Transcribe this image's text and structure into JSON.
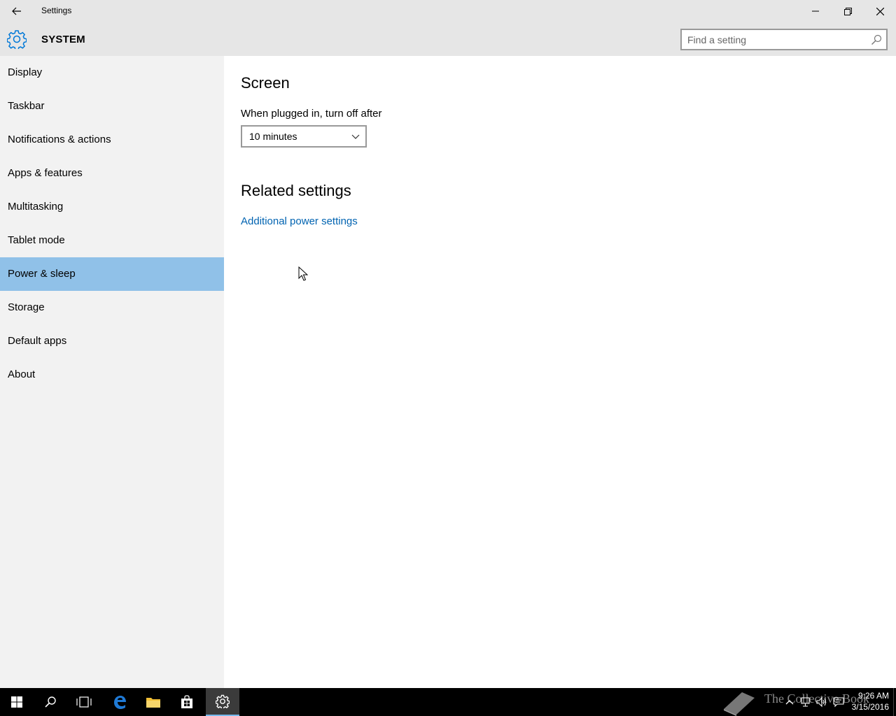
{
  "titlebar": {
    "title": "Settings"
  },
  "header": {
    "section_title": "SYSTEM",
    "search_placeholder": "Find a setting"
  },
  "sidebar": {
    "items": [
      {
        "label": "Display",
        "selected": false
      },
      {
        "label": "Taskbar",
        "selected": false
      },
      {
        "label": "Notifications & actions",
        "selected": false
      },
      {
        "label": "Apps & features",
        "selected": false
      },
      {
        "label": "Multitasking",
        "selected": false
      },
      {
        "label": "Tablet mode",
        "selected": false
      },
      {
        "label": "Power & sleep",
        "selected": true
      },
      {
        "label": "Storage",
        "selected": false
      },
      {
        "label": "Default apps",
        "selected": false
      },
      {
        "label": "About",
        "selected": false
      }
    ]
  },
  "main": {
    "screen_heading": "Screen",
    "plugged_label": "When plugged in, turn off after",
    "plugged_value": "10 minutes",
    "related_heading": "Related settings",
    "additional_power_link": "Additional power settings"
  },
  "taskbar": {
    "watermark": "The Collective Book",
    "time": "9:26 AM",
    "date": "3/15/2016"
  },
  "colors": {
    "accent": "#0078d7",
    "selected_nav": "#90c1e8",
    "link": "#0063b1"
  }
}
